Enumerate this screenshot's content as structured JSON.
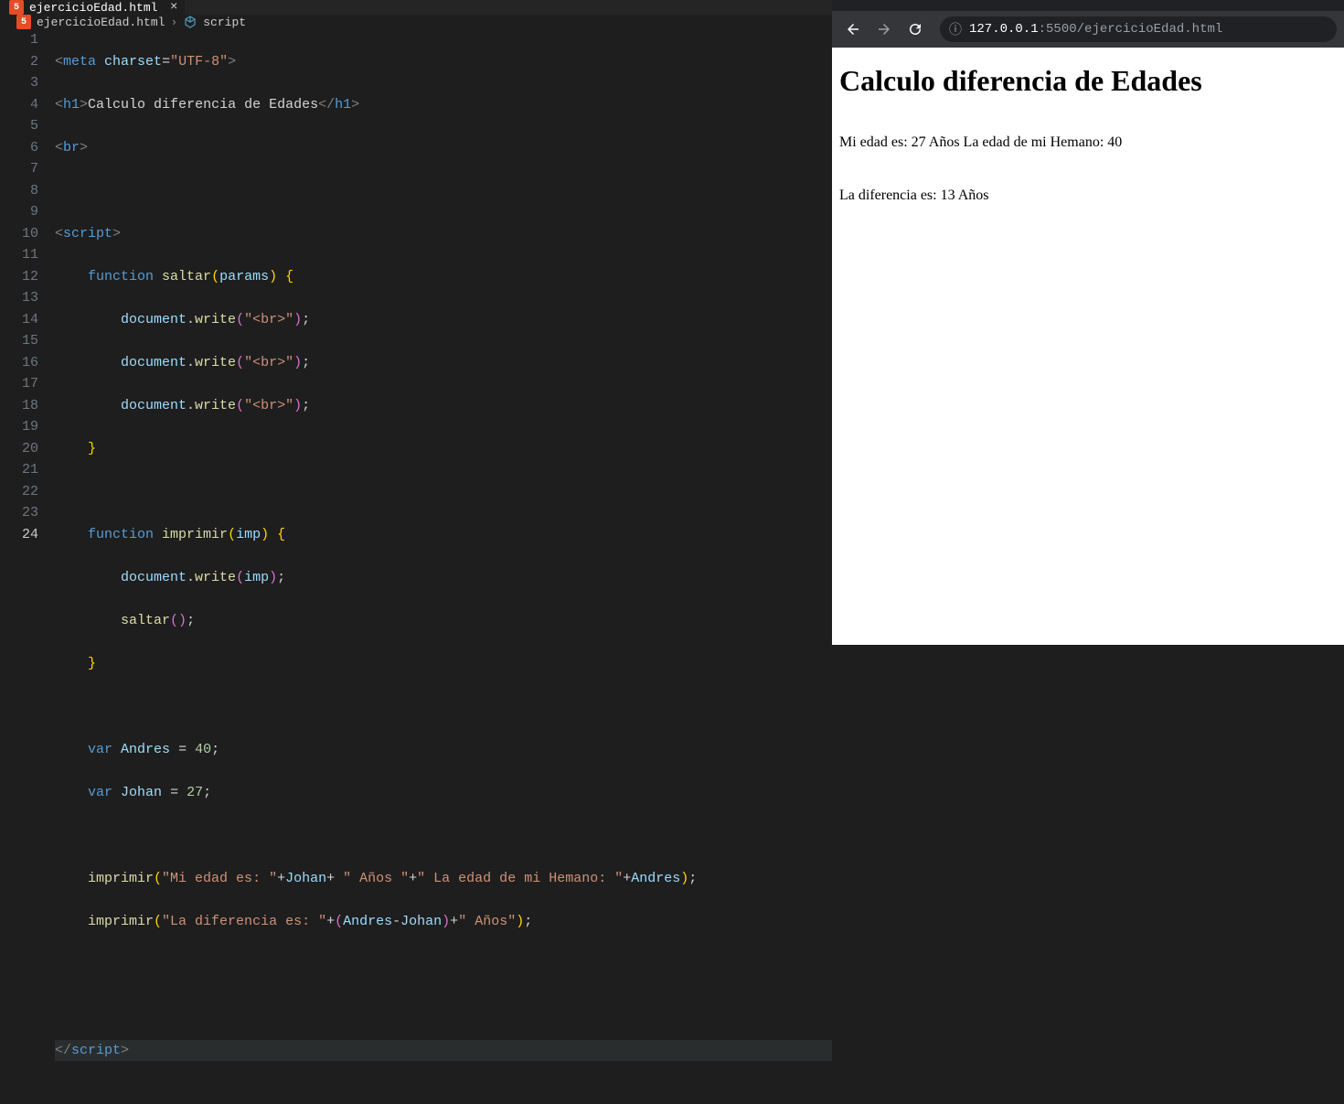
{
  "editor": {
    "tab": {
      "filename": "ejercicioEdad.html"
    },
    "breadcrumb": {
      "file": "ejercicioEdad.html",
      "symbol": "script"
    },
    "lineNumbers": [
      "1",
      "2",
      "3",
      "4",
      "5",
      "6",
      "7",
      "8",
      "9",
      "10",
      "11",
      "12",
      "13",
      "14",
      "15",
      "16",
      "17",
      "18",
      "19",
      "20",
      "21",
      "22",
      "23",
      "24"
    ],
    "code": {
      "l1": {
        "meta": "meta",
        "charset": "charset",
        "val": "\"UTF-8\""
      },
      "l2": {
        "h1o": "h1",
        "text": "Calculo diferencia de Edades",
        "h1c": "h1"
      },
      "l3": {
        "br": "br"
      },
      "l5": {
        "script": "script"
      },
      "l6": {
        "fn": "function",
        "name": "saltar",
        "param": "params"
      },
      "l7": {
        "obj": "document",
        "method": "write",
        "arg": "\"<br>\""
      },
      "l8": {
        "obj": "document",
        "method": "write",
        "arg": "\"<br>\""
      },
      "l9": {
        "obj": "document",
        "method": "write",
        "arg": "\"<br>\""
      },
      "l12": {
        "fn": "function",
        "name": "imprimir",
        "param": "imp"
      },
      "l13": {
        "obj": "document",
        "method": "write",
        "arg": "imp"
      },
      "l14": {
        "call": "saltar"
      },
      "l17": {
        "var": "var",
        "name": "Andres",
        "val": "40"
      },
      "l18": {
        "var": "var",
        "name": "Johan",
        "val": "27"
      },
      "l20": {
        "call": "imprimir",
        "s1": "\"Mi edad es: \"",
        "v1": "Johan",
        "s2": "\" Años \"",
        "s3": "\" La edad de mi Hemano: \"",
        "v2": "Andres"
      },
      "l21": {
        "call": "imprimir",
        "s1": "\"La diferencia es: \"",
        "v1": "Andres",
        "v2": "Johan",
        "s2": "\" Años\""
      },
      "l24": {
        "script": "script"
      }
    }
  },
  "browser": {
    "url": {
      "host": "127.0.0.1",
      "port": ":5500",
      "path": "/ejercicioEdad.html"
    },
    "page": {
      "heading": "Calculo diferencia de Edades",
      "line1": "Mi edad es: 27 Años La edad de mi Hemano: 40",
      "line2": "La diferencia es: 13 Años"
    }
  }
}
